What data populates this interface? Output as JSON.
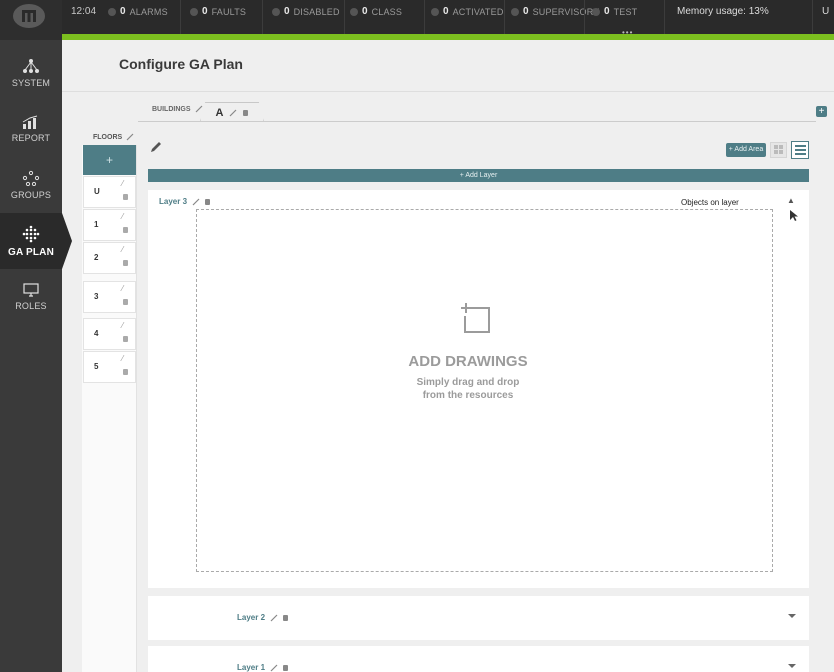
{
  "topbar": {
    "time": "12:04",
    "stats": [
      {
        "count": "0",
        "label": "ALARMS"
      },
      {
        "count": "0",
        "label": "FAULTS"
      },
      {
        "count": "0",
        "label": "DISABLED"
      },
      {
        "count": "0",
        "label": "CLASS"
      },
      {
        "count": "0",
        "label": "ACTIVATED"
      },
      {
        "count": "0",
        "label": "SUPERVISORY"
      },
      {
        "count": "0",
        "label": "TEST"
      }
    ],
    "memory": "Memory usage: 13%",
    "user_initial": "U",
    "accent_color": "#7cbf1f"
  },
  "sidebar": {
    "items": [
      {
        "label": "SYSTEM",
        "icon": "network-icon"
      },
      {
        "label": "REPORT",
        "icon": "bar-chart-icon"
      },
      {
        "label": "GROUPS",
        "icon": "groups-icon"
      },
      {
        "label": "GA PLAN",
        "icon": "dot-grid-icon",
        "active": true
      },
      {
        "label": "ROLES",
        "icon": "monitor-icon"
      }
    ]
  },
  "header": {
    "title": "Configure GA Plan"
  },
  "buildings": {
    "label": "BUILDINGS",
    "tabs": [
      {
        "name": "A"
      }
    ]
  },
  "floors": {
    "label": "FLOORS",
    "add_label": "+",
    "items": [
      {
        "name": "U"
      },
      {
        "name": "1"
      },
      {
        "name": "2"
      },
      {
        "name": "3"
      },
      {
        "name": "4"
      },
      {
        "name": "5"
      }
    ]
  },
  "toolbar": {
    "add_area_label": "+ Add Area",
    "add_layer_label": "+ Add Layer"
  },
  "layers": {
    "expanded": {
      "title": "Layer 3",
      "objects_label": "Objects on layer",
      "drop_title": "ADD DRAWINGS",
      "drop_line1": "Simply drag and drop",
      "drop_line2": "from the resources"
    },
    "collapsed": [
      {
        "title": "Layer 2"
      },
      {
        "title": "Layer 1"
      }
    ]
  },
  "colors": {
    "primary": "#4e7d86",
    "sidebar": "#3a3a3a",
    "topbar": "#2a2a2a"
  }
}
